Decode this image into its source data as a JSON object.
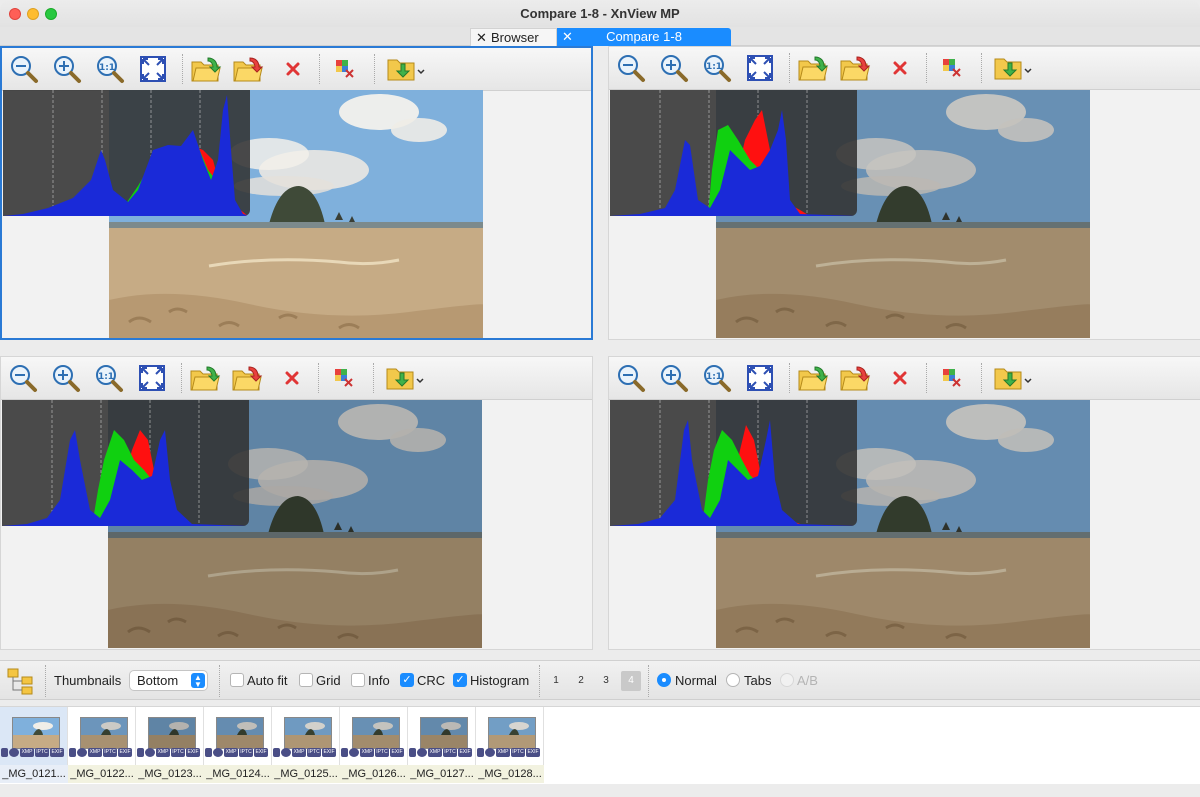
{
  "window": {
    "title": "Compare 1-8 - XnView MP"
  },
  "tabs": [
    {
      "label": "Browser",
      "close": "✕"
    },
    {
      "label": "Compare 1-8",
      "close": "✕"
    }
  ],
  "toolbar_icons": [
    "zoom-out-icon",
    "zoom-in-icon",
    "zoom-actual-size-icon",
    "fit-to-window-icon",
    "open-file-icon",
    "save-file-icon",
    "delete-icon",
    "compare-diff-icon",
    "folder-move-icon"
  ],
  "bottombar": {
    "thumbnails_label": "Thumbnails",
    "thumbnails_position": "Bottom",
    "checkboxes": [
      {
        "label": "Auto fit",
        "checked": false
      },
      {
        "label": "Grid",
        "checked": false
      },
      {
        "label": "Info",
        "checked": false
      },
      {
        "label": "CRC",
        "checked": true
      },
      {
        "label": "Histogram",
        "checked": true
      }
    ],
    "layout_numbers": [
      "1",
      "2",
      "3",
      "4"
    ],
    "selected_layout": "4",
    "modes": [
      {
        "label": "Normal",
        "selected": true,
        "enabled": true
      },
      {
        "label": "Tabs",
        "selected": false,
        "enabled": true
      },
      {
        "label": "A/B",
        "selected": false,
        "enabled": false
      }
    ]
  },
  "thumbnails": [
    {
      "name": "_MG_0121...",
      "badges": [
        "XMP",
        "IPTC",
        "EXIF"
      ]
    },
    {
      "name": "_MG_0122...",
      "badges": [
        "XMP",
        "IPTC",
        "EXIF"
      ]
    },
    {
      "name": "_MG_0123...",
      "badges": [
        "XMP",
        "IPTC",
        "EXIF"
      ]
    },
    {
      "name": "_MG_0124...",
      "badges": [
        "XMP",
        "IPTC",
        "EXIF"
      ]
    },
    {
      "name": "_MG_0125...",
      "badges": [
        "XMP",
        "IPTC",
        "EXIF"
      ]
    },
    {
      "name": "_MG_0126...",
      "badges": [
        "XMP",
        "IPTC",
        "EXIF"
      ]
    },
    {
      "name": "_MG_0127...",
      "badges": [
        "XMP",
        "IPTC",
        "EXIF"
      ]
    },
    {
      "name": "_MG_0128...",
      "badges": [
        "XMP",
        "IPTC",
        "EXIF"
      ]
    }
  ],
  "colors": {
    "accent": "#1a8cff",
    "active_pane_border": "#2a7ad5",
    "histogram_red": "#ff1010",
    "histogram_green": "#10d010",
    "histogram_blue": "#1a2ad8"
  }
}
